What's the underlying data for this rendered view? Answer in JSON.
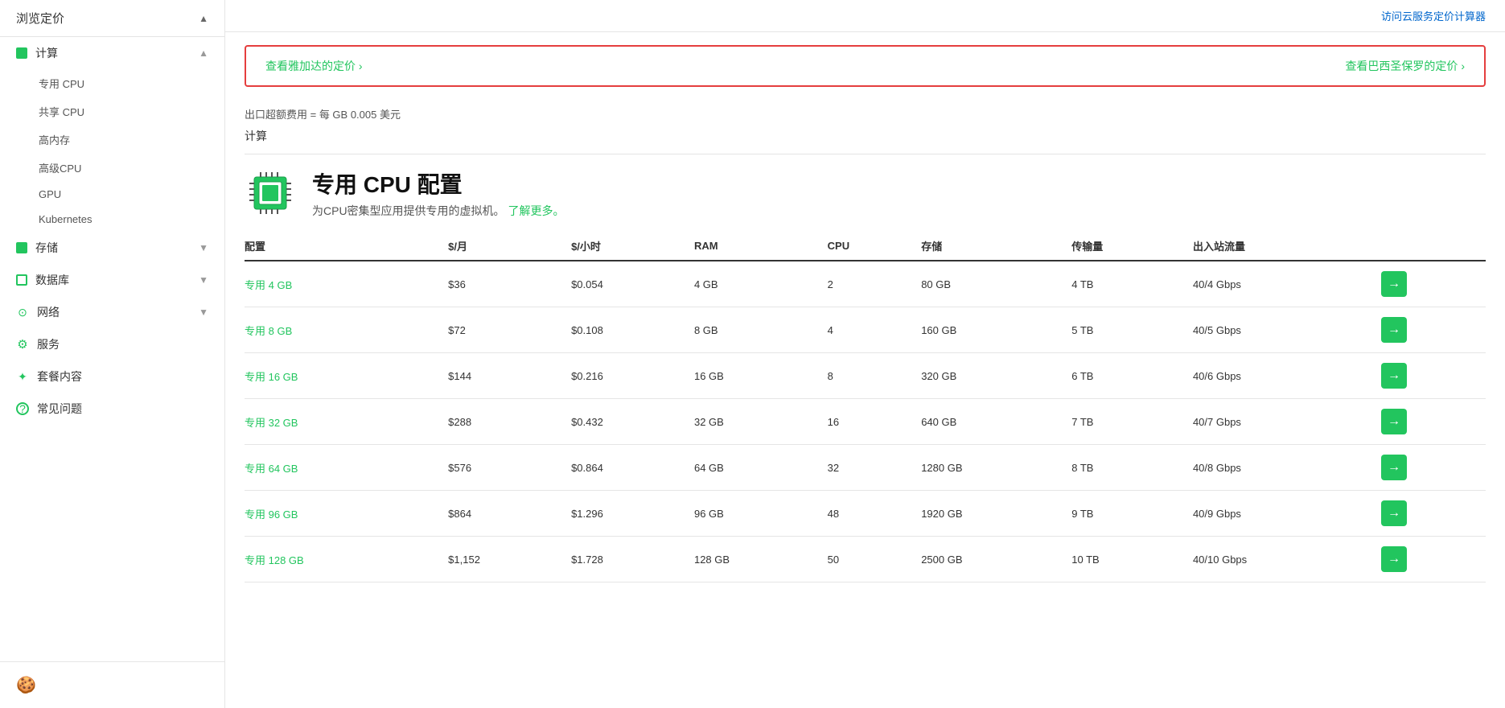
{
  "sidebar": {
    "header_label": "浏览定价",
    "sections": [
      {
        "id": "compute",
        "label": "计算",
        "icon_type": "green_square",
        "expanded": true,
        "sub_items": [
          {
            "label": "专用 CPU",
            "id": "dedicated-cpu"
          },
          {
            "label": "共享 CPU",
            "id": "shared-cpu"
          },
          {
            "label": "高内存",
            "id": "high-memory"
          },
          {
            "label": "高级CPU",
            "id": "premium-cpu"
          },
          {
            "label": "GPU",
            "id": "gpu"
          },
          {
            "label": "Kubernetes",
            "id": "kubernetes"
          }
        ]
      },
      {
        "id": "storage",
        "label": "存储",
        "icon_type": "green_square",
        "expanded": false
      },
      {
        "id": "database",
        "label": "数据库",
        "icon_type": "green_circle_outline",
        "expanded": false
      },
      {
        "id": "network",
        "label": "网络",
        "icon_type": "network",
        "expanded": false
      },
      {
        "id": "services",
        "label": "服务",
        "icon_type": "gear",
        "expanded": false
      },
      {
        "id": "bundles",
        "label": "套餐内容",
        "icon_type": "bundle",
        "expanded": false
      },
      {
        "id": "faq",
        "label": "常见问题",
        "icon_type": "question",
        "expanded": false
      }
    ]
  },
  "topbar": {
    "link_label": "访问云服务定价计算器"
  },
  "banner": {
    "left_link": "查看雅加达的定价 ›",
    "right_link": "查看巴西圣保罗的定价 ›"
  },
  "info": {
    "egress_label": "出口超额费用 = 每 GB 0.005 美元"
  },
  "section_label": "计算",
  "product": {
    "title": "专用 CPU 配置",
    "desc_text": "为CPU密集型应用提供专用的虚拟机。",
    "desc_link": "了解更多。",
    "table": {
      "columns": [
        "配置",
        "$/月",
        "$/小时",
        "RAM",
        "CPU",
        "存储",
        "传输量",
        "出入站流量"
      ],
      "rows": [
        {
          "name": "专用 4 GB",
          "monthly": "$36",
          "hourly": "$0.054",
          "ram": "4 GB",
          "cpu": "2",
          "storage": "80 GB",
          "transfer": "4 TB",
          "network": "40/4 Gbps"
        },
        {
          "name": "专用 8 GB",
          "monthly": "$72",
          "hourly": "$0.108",
          "ram": "8 GB",
          "cpu": "4",
          "storage": "160 GB",
          "transfer": "5 TB",
          "network": "40/5 Gbps"
        },
        {
          "name": "专用 16 GB",
          "monthly": "$144",
          "hourly": "$0.216",
          "ram": "16 GB",
          "cpu": "8",
          "storage": "320 GB",
          "transfer": "6 TB",
          "network": "40/6 Gbps"
        },
        {
          "name": "专用 32 GB",
          "monthly": "$288",
          "hourly": "$0.432",
          "ram": "32 GB",
          "cpu": "16",
          "storage": "640 GB",
          "transfer": "7 TB",
          "network": "40/7 Gbps"
        },
        {
          "name": "专用 64 GB",
          "monthly": "$576",
          "hourly": "$0.864",
          "ram": "64 GB",
          "cpu": "32",
          "storage": "1280 GB",
          "transfer": "8 TB",
          "network": "40/8 Gbps"
        },
        {
          "name": "专用 96 GB",
          "monthly": "$864",
          "hourly": "$1.296",
          "ram": "96 GB",
          "cpu": "48",
          "storage": "1920 GB",
          "transfer": "9 TB",
          "network": "40/9 Gbps"
        },
        {
          "name": "专用 128 GB",
          "monthly": "$1,152",
          "hourly": "$1.728",
          "ram": "128 GB",
          "cpu": "50",
          "storage": "2500 GB",
          "transfer": "10 TB",
          "network": "40/10 Gbps"
        }
      ]
    }
  },
  "colors": {
    "green": "#22c55e",
    "red_border": "#e53e3e"
  }
}
